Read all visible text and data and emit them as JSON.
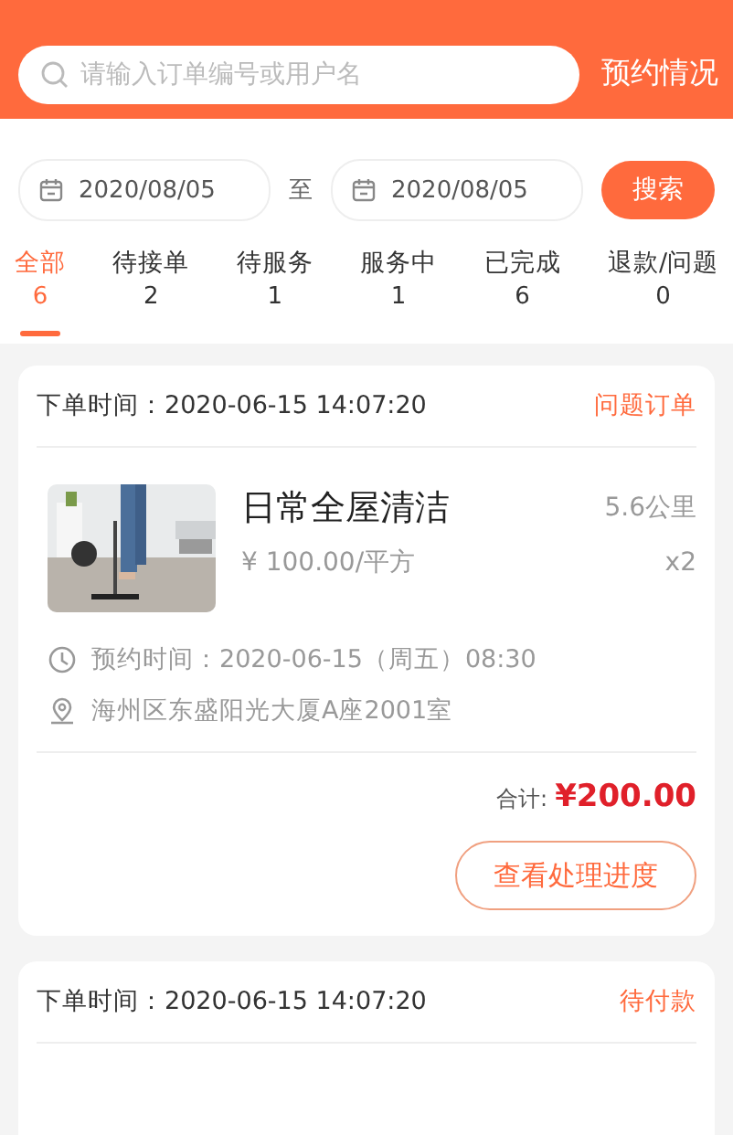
{
  "search": {
    "placeholder": "请输入订单编号或用户名"
  },
  "header_link": "预约情况",
  "date_range": {
    "start": "2020/08/05",
    "separator": "至",
    "end": "2020/08/05",
    "button": "搜索"
  },
  "tabs": [
    {
      "label": "全部",
      "count": "6",
      "selected": true
    },
    {
      "label": "待接单",
      "count": "2",
      "selected": false
    },
    {
      "label": "待服务",
      "count": "1",
      "selected": false
    },
    {
      "label": "服务中",
      "count": "1",
      "selected": false
    },
    {
      "label": "已完成",
      "count": "6",
      "selected": false
    },
    {
      "label": "退款/问题",
      "count": "0",
      "selected": false
    }
  ],
  "orders": [
    {
      "kind": "full",
      "order_time": "下单时间：2020-06-15  14:07:20",
      "status": "问题订单",
      "title": "日常全屋清洁",
      "distance": "5.6公里",
      "price": "¥ 100.00/平方",
      "quantity": "x2",
      "appointment": "预约时间：2020-06-15（周五）08:30",
      "address": "海州区东盛阳光大厦A座2001室",
      "total_label": "合计:",
      "total": "¥200.00",
      "action": "查看处理进度"
    },
    {
      "kind": "header",
      "order_time": "下单时间：2020-06-15  14:07:20",
      "status": "待付款"
    }
  ]
}
